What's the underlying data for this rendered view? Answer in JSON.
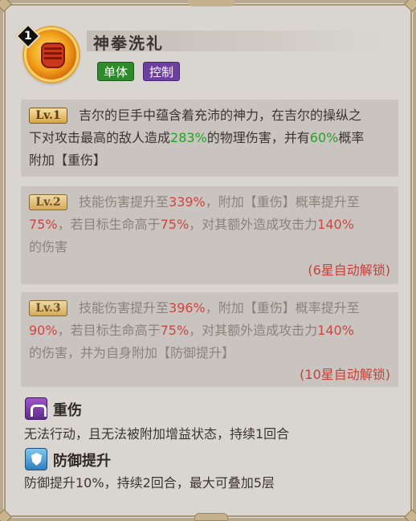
{
  "skill": {
    "level": "1",
    "icon": "fist-icon",
    "name": "神拳洗礼",
    "tags": [
      "单体",
      "控制"
    ]
  },
  "levels": [
    {
      "badge": "Lv.1",
      "lines": [
        [
          "吉尔的巨手中蕴含着充沛的神力，在吉尔的操纵之"
        ],
        [
          "下对攻击最高的敌人造成",
          "283%",
          "的物理伤害，并有",
          "60%",
          "概率"
        ],
        [
          "附加【重伤】"
        ]
      ]
    },
    {
      "badge": "Lv.2",
      "lines": [
        [
          "技能伤害提升至",
          "339%",
          "，附加【重伤】概率提升至"
        ],
        [
          "75%",
          "，若目标生命高于",
          "75%",
          "，对其额外造成攻击力",
          "140%"
        ],
        [
          "的伤害"
        ]
      ],
      "unlock": "(6星自动解锁)"
    },
    {
      "badge": "Lv.3",
      "lines": [
        [
          "技能伤害提升至",
          "396%",
          "，附加【重伤】概率提升至"
        ],
        [
          "90%",
          "，若目标生命高于",
          "75%",
          "，对其额外造成攻击力",
          "140%"
        ],
        [
          "的伤害，并为自身附加【防御提升】"
        ]
      ],
      "unlock": "(10星自动解锁)"
    }
  ],
  "effects": [
    {
      "icon": "grievous-wound-icon",
      "name": "重伤",
      "desc": "无法行动，且无法被附加增益状态，持续1回合"
    },
    {
      "icon": "defense-up-icon",
      "name": "防御提升",
      "desc": "防御提升10%，持续2回合，最大可叠加5层"
    }
  ],
  "colors": {
    "green": "#28a12a",
    "red": "#d0453f",
    "tag_green": "#2f8a2c",
    "tag_purple": "#6f3ea1"
  }
}
